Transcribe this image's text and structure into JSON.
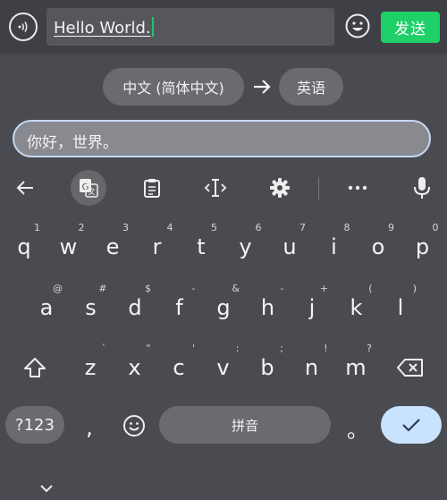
{
  "chat_bar": {
    "input_text": "Hello World.",
    "send_label": "发送"
  },
  "translate": {
    "source_language": "中文 (简体中文)",
    "target_language": "英语",
    "input_text": "你好，世界。"
  },
  "toolbar": {
    "items": [
      "back-arrow",
      "translate",
      "clipboard",
      "text-cursor",
      "settings",
      "more",
      "microphone"
    ]
  },
  "keyboard": {
    "row1": [
      [
        "q",
        "1"
      ],
      [
        "w",
        "2"
      ],
      [
        "e",
        "3"
      ],
      [
        "r",
        "4"
      ],
      [
        "t",
        "5"
      ],
      [
        "y",
        "6"
      ],
      [
        "u",
        "7"
      ],
      [
        "i",
        "8"
      ],
      [
        "o",
        "9"
      ],
      [
        "p",
        "0"
      ]
    ],
    "row2": [
      [
        "a",
        "@"
      ],
      [
        "s",
        "#"
      ],
      [
        "d",
        "$"
      ],
      [
        "f",
        "-"
      ],
      [
        "g",
        "&"
      ],
      [
        "h",
        "-"
      ],
      [
        "j",
        "+"
      ],
      [
        "k",
        "("
      ],
      [
        "l",
        ")"
      ]
    ],
    "row3": [
      [
        "z",
        "`"
      ],
      [
        "x",
        "\""
      ],
      [
        "c",
        "'"
      ],
      [
        "v",
        ":"
      ],
      [
        "b",
        ";"
      ],
      [
        "n",
        "!"
      ],
      [
        "m",
        "?"
      ]
    ],
    "symbols_label": "?123",
    "comma": ",",
    "space_label": "拼音",
    "period": "。"
  },
  "colors": {
    "background": "#4a4b50",
    "send_button": "#1fcf68",
    "enter_key": "#c9e3ff",
    "field_border": "#c5d7f2"
  }
}
